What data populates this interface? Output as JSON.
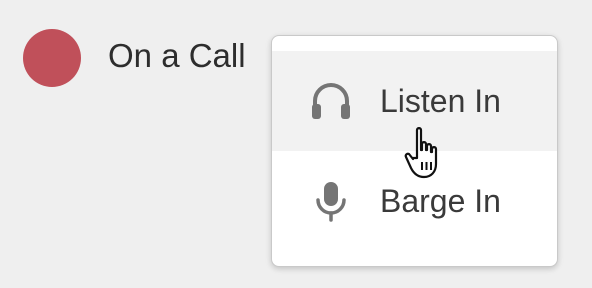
{
  "status": {
    "label": "On a Call",
    "dot_color": "#c0505a",
    "icon": "status-dot"
  },
  "menu": {
    "items": [
      {
        "label": "Listen In",
        "icon": "headphones-icon",
        "highlighted": true
      },
      {
        "label": "Barge In",
        "icon": "microphone-icon",
        "highlighted": false
      }
    ]
  },
  "cursor": {
    "icon": "hand-pointer-icon"
  }
}
